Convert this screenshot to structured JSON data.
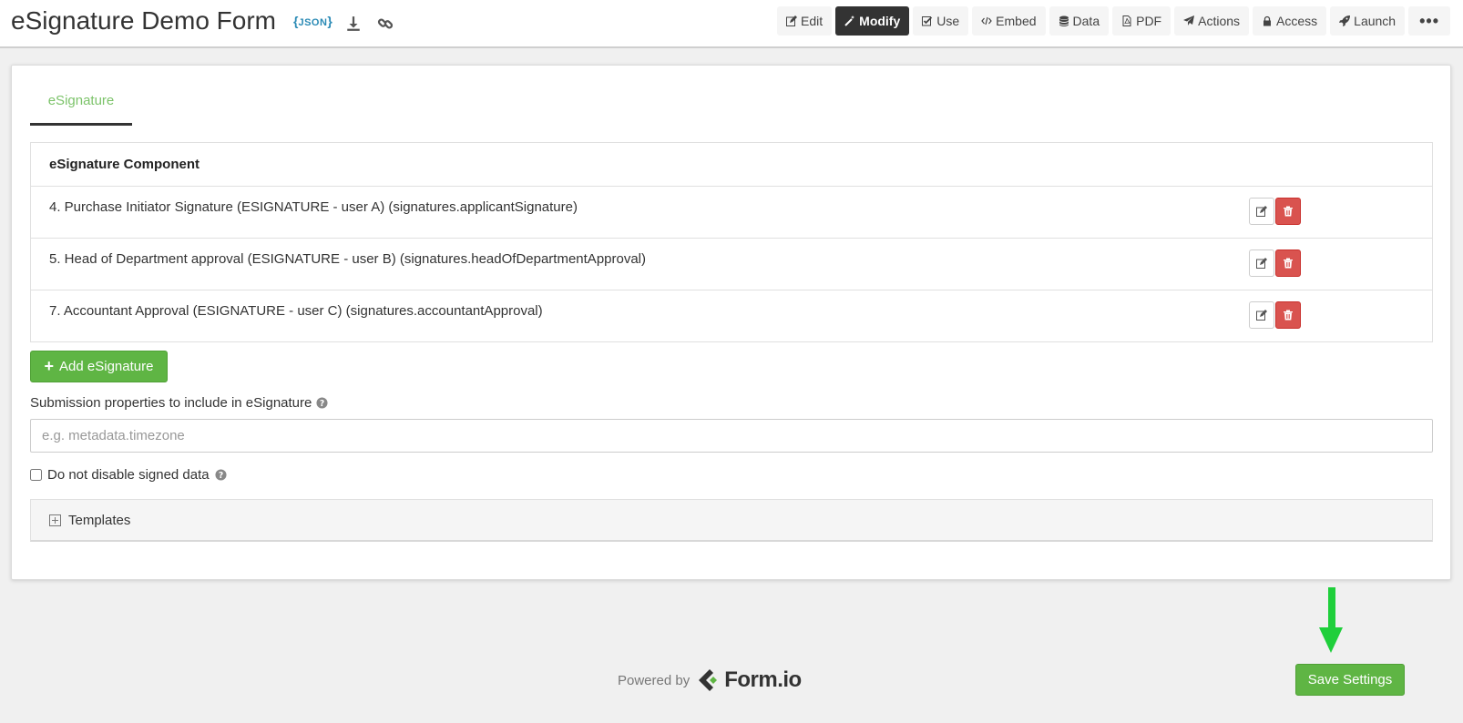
{
  "header": {
    "title": "eSignature Demo Form",
    "json_badge": "JSON",
    "nav": [
      {
        "label": "Edit",
        "icon": "edit-icon"
      },
      {
        "label": "Modify",
        "icon": "magic-wand-icon",
        "active": true
      },
      {
        "label": "Use",
        "icon": "check-square-icon"
      },
      {
        "label": "Embed",
        "icon": "code-icon"
      },
      {
        "label": "Data",
        "icon": "database-icon"
      },
      {
        "label": "PDF",
        "icon": "pdf-icon"
      },
      {
        "label": "Actions",
        "icon": "paper-plane-icon"
      },
      {
        "label": "Access",
        "icon": "lock-icon"
      },
      {
        "label": "Launch",
        "icon": "rocket-icon"
      }
    ],
    "more_label": "•••"
  },
  "tab": {
    "label": "eSignature"
  },
  "table": {
    "header": "eSignature Component",
    "rows": [
      {
        "text": "4. Purchase Initiator Signature (ESIGNATURE - user A) (signatures.applicantSignature)"
      },
      {
        "text": "5. Head of Department approval (ESIGNATURE - user B) (signatures.headOfDepartmentApproval)"
      },
      {
        "text": "7. Accountant Approval (ESIGNATURE - user C) (signatures.accountantApproval)"
      }
    ]
  },
  "add_button": {
    "label": "Add eSignature"
  },
  "submission_props": {
    "label": "Submission properties to include in eSignature",
    "placeholder": "e.g. metadata.timezone",
    "value": ""
  },
  "checkbox": {
    "label": "Do not disable signed data",
    "checked": false
  },
  "templates": {
    "label": "Templates"
  },
  "footer": {
    "powered_by": "Powered by",
    "logo_text": "Form.io"
  },
  "save_button": {
    "label": "Save Settings"
  },
  "colors": {
    "primary_green": "#5fb544",
    "tab_green": "#7cc36a",
    "danger": "#d9534f",
    "active_nav": "#333333",
    "arrow": "#1fcf3b"
  }
}
